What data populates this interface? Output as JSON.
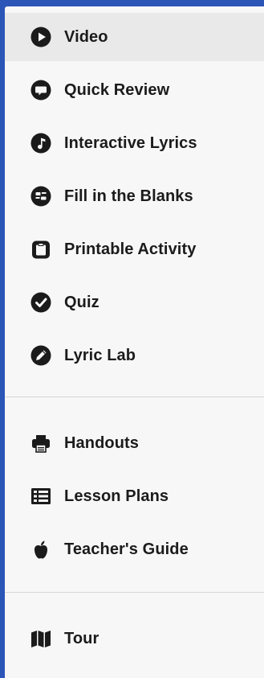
{
  "menu": {
    "primary": [
      {
        "label": "Video",
        "icon": "play-circle-icon"
      },
      {
        "label": "Quick Review",
        "icon": "speech-bubble-icon"
      },
      {
        "label": "Interactive Lyrics",
        "icon": "music-note-circle-icon"
      },
      {
        "label": "Fill in the Blanks",
        "icon": "fill-blanks-icon"
      },
      {
        "label": "Printable Activity",
        "icon": "clipboard-icon"
      },
      {
        "label": "Quiz",
        "icon": "check-circle-icon"
      },
      {
        "label": "Lyric Lab",
        "icon": "pencil-circle-icon"
      }
    ],
    "teacher": [
      {
        "label": "Handouts",
        "icon": "printer-icon"
      },
      {
        "label": "Lesson Plans",
        "icon": "list-icon"
      },
      {
        "label": "Teacher's Guide",
        "icon": "apple-icon"
      }
    ],
    "extra": [
      {
        "label": "Tour",
        "icon": "map-icon"
      }
    ]
  },
  "colors": {
    "frame_background": "#2c55b8",
    "panel_background": "#f7f7f7",
    "active_background": "#e9e9e9",
    "text": "#1b1b1b",
    "divider": "#d6d6d6"
  }
}
